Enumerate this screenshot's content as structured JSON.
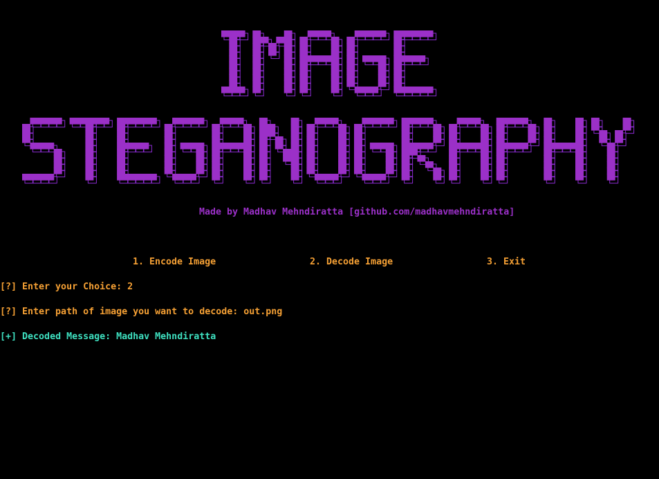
{
  "colors": {
    "background": "#000000",
    "banner_fill": "#9b30c8",
    "banner_outline": "#8a2bd0",
    "prompt_text": "#f5a034",
    "success_text": "#3ee0c0"
  },
  "banner": {
    "line1": "IMAGE",
    "line2": "STEGANOGRAPHY"
  },
  "credit": "Made by Madhav Mehndiratta [github.com/madhavmehndiratta]",
  "menu": {
    "option1": "1. Encode Image",
    "option2": "2. Decode Image",
    "option3": "3. Exit"
  },
  "session": {
    "choice_prompt": "[?] Enter your Choice: 2",
    "path_prompt": "[?] Enter path of image you want to decode: out.png",
    "result_marker": "[+]",
    "result_text": " Decoded Message: Madhav Mehndiratta"
  }
}
